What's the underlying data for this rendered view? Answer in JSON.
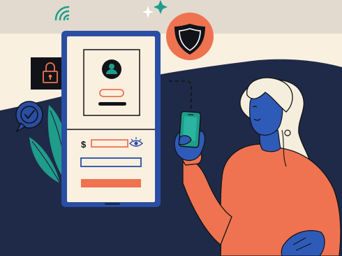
{
  "illustration": {
    "theme": "secure mobile payment / login",
    "icons": [
      "wifi-icon",
      "sparkle-icon",
      "shield-icon",
      "padlock-icon",
      "checkmark-icon",
      "user-avatar-icon",
      "dollar-icon",
      "eye-icon",
      "phone-icon"
    ],
    "colors": {
      "cream": "#faf0e0",
      "beige_band": "#e2dace",
      "navy": "#1f2a48",
      "blue": "#2a4ea3",
      "coral": "#ef7350",
      "green": "#1f9c8a",
      "skin": "#2f5bb8",
      "hair": "#f6eedc",
      "black": "#111318"
    }
  },
  "phone_screen": {
    "currency_symbol": "$"
  }
}
